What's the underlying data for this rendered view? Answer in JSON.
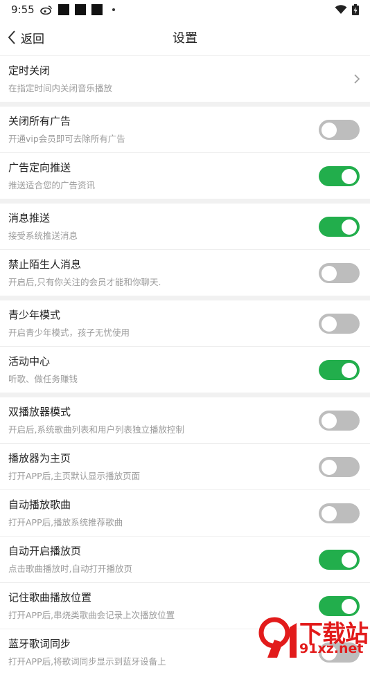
{
  "status_bar": {
    "time": "9:55"
  },
  "header": {
    "back_label": "返回",
    "title": "设置"
  },
  "groups": [
    {
      "rows": [
        {
          "title": "定时关闭",
          "subtitle": "在指定时间内关闭音乐播放",
          "control": "chevron"
        }
      ]
    },
    {
      "rows": [
        {
          "title": "关闭所有广告",
          "subtitle": "开通vip会员即可去除所有广告",
          "control": "toggle",
          "on": false
        },
        {
          "title": "广告定向推送",
          "subtitle": "推送适合您的广告资讯",
          "control": "toggle",
          "on": true
        }
      ]
    },
    {
      "rows": [
        {
          "title": "消息推送",
          "subtitle": "接受系统推送消息",
          "control": "toggle",
          "on": true
        },
        {
          "title": "禁止陌生人消息",
          "subtitle": "开启后,只有你关注的会员才能和你聊天.",
          "control": "toggle",
          "on": false
        }
      ]
    },
    {
      "rows": [
        {
          "title": "青少年模式",
          "subtitle": "开启青少年模式，孩子无忧使用",
          "control": "toggle",
          "on": false
        },
        {
          "title": "活动中心",
          "subtitle": "听歌、做任务赚钱",
          "control": "toggle",
          "on": true
        }
      ]
    },
    {
      "rows": [
        {
          "title": "双播放器模式",
          "subtitle": "开启后,系统歌曲列表和用户列表独立播放控制",
          "control": "toggle",
          "on": false
        },
        {
          "title": "播放器为主页",
          "subtitle": "打开APP后,主页默认显示播放页面",
          "control": "toggle",
          "on": false
        },
        {
          "title": "自动播放歌曲",
          "subtitle": "打开APP后,播放系统推荐歌曲",
          "control": "toggle",
          "on": false
        },
        {
          "title": "自动开启播放页",
          "subtitle": "点击歌曲播放时,自动打开播放页",
          "control": "toggle",
          "on": true
        },
        {
          "title": "记住歌曲播放位置",
          "subtitle": "打开APP后,串烧类歌曲会记录上次播放位置",
          "control": "toggle",
          "on": true
        },
        {
          "title": "蓝牙歌词同步",
          "subtitle": "打开APP后,将歌词同步显示到蓝牙设备上",
          "control": "toggle",
          "on": false
        }
      ]
    }
  ],
  "watermark": {
    "text": "下载站",
    "url": "91xz.net"
  },
  "colors": {
    "toggle_on": "#22ae4c",
    "toggle_off": "#bdbdbd",
    "separator": "#f1f1f1",
    "watermark": "#e21b1b"
  },
  "icons": {
    "back": "chevron-left-icon",
    "row_arrow": "chevron-right-icon"
  }
}
